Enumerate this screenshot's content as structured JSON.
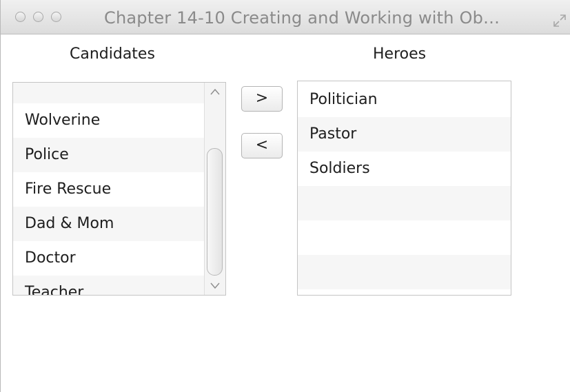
{
  "window": {
    "title": "Chapter 14-10 Creating and Working with Ob…"
  },
  "candidates": {
    "label": "Candidates",
    "items": [
      "Wolverine",
      "Police",
      "Fire Rescue",
      "Dad & Mom",
      "Doctor",
      "Teacher"
    ]
  },
  "heroes": {
    "label": "Heroes",
    "items": [
      "Politician",
      "Pastor",
      "Soldiers"
    ]
  },
  "buttons": {
    "add_label": ">",
    "remove_label": "<"
  },
  "icons": {
    "close": "close-button-icon",
    "minimize": "minimize-button-icon",
    "zoom": "zoom-button-icon",
    "fullscreen": "fullscreen-arrows-icon",
    "scroll_up": "chevron-up-icon",
    "scroll_down": "chevron-down-icon"
  }
}
